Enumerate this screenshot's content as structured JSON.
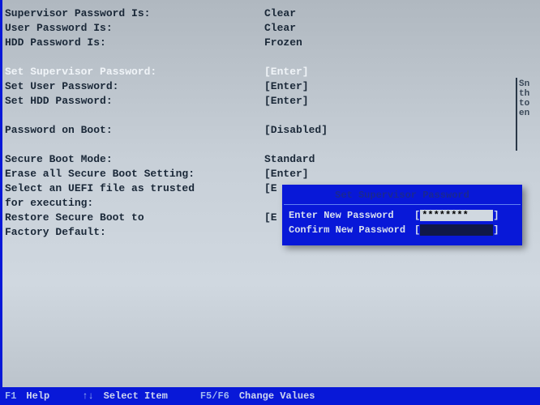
{
  "settings": {
    "supervisor_pwd_label": "Supervisor Password Is:",
    "supervisor_pwd_value": "Clear",
    "user_pwd_label": "User Password Is:",
    "user_pwd_value": "Clear",
    "hdd_pwd_label": "HDD Password Is:",
    "hdd_pwd_value": "Frozen",
    "set_supervisor_label": "Set Supervisor Password:",
    "set_supervisor_value": "[Enter]",
    "set_user_label": "Set User Password:",
    "set_user_value": "[Enter]",
    "set_hdd_label": "Set HDD Password:",
    "set_hdd_value": "[Enter]",
    "pwd_on_boot_label": "Password on Boot:",
    "pwd_on_boot_value": "[Disabled]",
    "secure_boot_label": "Secure Boot Mode:",
    "secure_boot_value": "Standard",
    "erase_secure_label": "Erase all Secure Boot Setting:",
    "erase_secure_value": "[Enter]",
    "select_uefi_label1": "Select an UEFI file as trusted",
    "select_uefi_label2": "for executing:",
    "select_uefi_value": "[E",
    "restore_label1": "Restore Secure Boot to",
    "restore_label2": "Factory Default:",
    "restore_value": "[E"
  },
  "help_panel": "Sn th to en",
  "dialog": {
    "title": "Set Supervisor Password",
    "enter_label": "Enter New Password",
    "enter_value": "********",
    "confirm_label": "Confirm New Password",
    "confirm_value": ""
  },
  "bottombar": {
    "f1_key": "F1",
    "f1_text": "Help",
    "arrows_key": "↑↓",
    "arrows_text": "Select Item",
    "f5f6_key": "F5/F6",
    "f5f6_text": "Change Values"
  }
}
